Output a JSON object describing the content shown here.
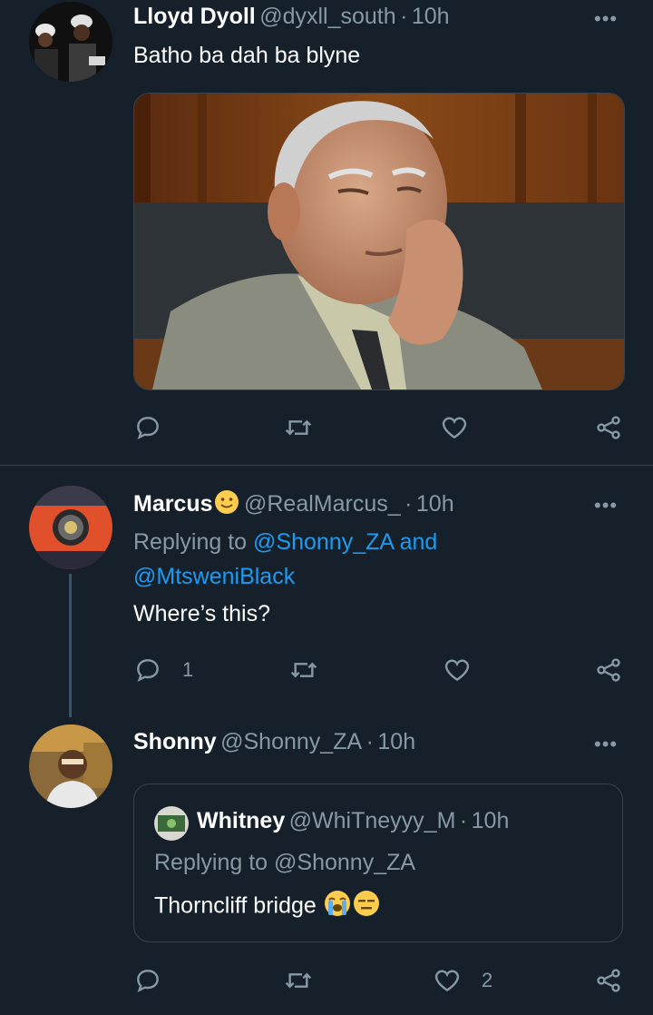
{
  "tweets": [
    {
      "name": "Lloyd Dyoll",
      "handle": "@dyxll_south",
      "time": "10h",
      "text": "Batho ba dah ba blyne",
      "media_alt": "photo",
      "actions": {
        "reply_count": "",
        "retweet_count": "",
        "like_count": ""
      }
    },
    {
      "name": "Marcus",
      "name_emoji": "slightly-smiling-face",
      "handle": "@RealMarcus_",
      "time": "10h",
      "replying_prefix": "Replying to",
      "replying_mention_1": "@Shonny_ZA",
      "replying_and": "and",
      "replying_mention_2": "@MtsweniBlack",
      "text": "Where’s this?",
      "actions": {
        "reply_count": "1",
        "retweet_count": "",
        "like_count": ""
      }
    },
    {
      "name": "Shonny",
      "handle": "@Shonny_ZA",
      "time": "10h",
      "quote": {
        "name": "Whitney",
        "handle": "@WhiTneyyy_M",
        "time": "10h",
        "replying_prefix": "Replying to",
        "replying_mention": "@Shonny_ZA",
        "text": "Thorncliff bridge",
        "emojis": [
          "loudly-crying-face",
          "expressionless-face"
        ]
      },
      "actions": {
        "reply_count": "",
        "retweet_count": "",
        "like_count": "2"
      }
    }
  ],
  "separator": "·",
  "more_label": "•••",
  "colors": {
    "background": "#15202b",
    "secondary_text": "#8899a6",
    "link": "#1d9bf0",
    "divider": "#38444d"
  },
  "icons": [
    "reply-icon",
    "retweet-icon",
    "like-icon",
    "share-icon",
    "more-icon"
  ]
}
